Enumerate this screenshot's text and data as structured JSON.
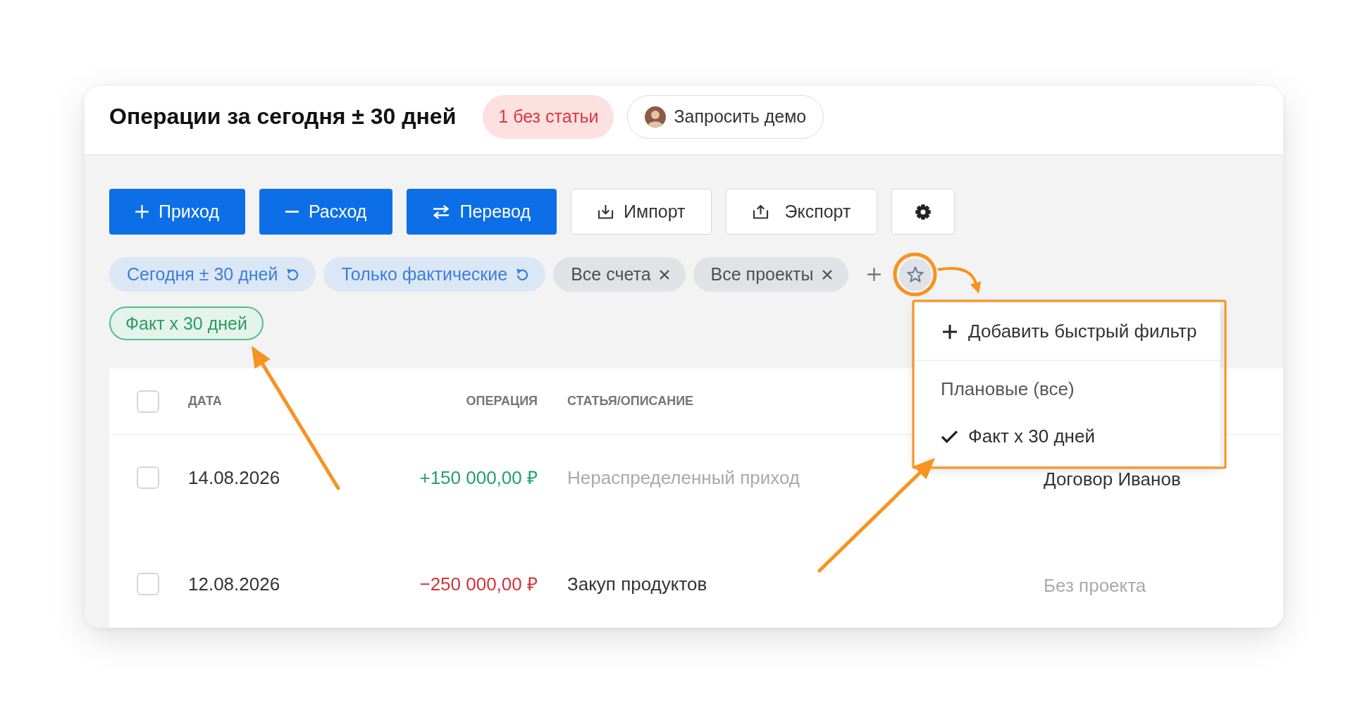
{
  "header": {
    "title": "Операции за сегодня ± 30 дней",
    "badge": "1 без статьи",
    "demo_button": "Запросить демо"
  },
  "toolbar": [
    {
      "kind": "income",
      "label": "Приход"
    },
    {
      "kind": "expense",
      "label": "Расход"
    },
    {
      "kind": "transfer",
      "label": "Перевод"
    },
    {
      "kind": "import",
      "label": "Импорт"
    },
    {
      "kind": "export",
      "label": "Экспорт"
    },
    {
      "kind": "settings"
    }
  ],
  "filters": [
    {
      "kind": "reset",
      "label": "Сегодня ± 30 дней"
    },
    {
      "kind": "reset",
      "label": "Только фактические"
    },
    {
      "kind": "removable",
      "label": "Все счета"
    },
    {
      "kind": "removable",
      "label": "Все проекты"
    }
  ],
  "quick_filter_menu": {
    "expanded": true,
    "add_label": "Добавить быстрый фильтр",
    "items": [
      {
        "label": "Плановые (все)",
        "selected": false
      },
      {
        "label": "Факт х 30 дней",
        "selected": true
      }
    ]
  },
  "active_quick_filters": [
    {
      "label": "Факт х 30 дней"
    }
  ],
  "table": {
    "header_checked": false,
    "columns": [
      {
        "label": "ДАТА"
      },
      {
        "label": "ОПЕРАЦИЯ"
      },
      {
        "label": "СТАТЬЯ/ОПИСАНИЕ"
      }
    ],
    "rows": [
      {
        "checked": false,
        "date": "14.08.2026",
        "amount": {
          "kind": "income",
          "text": "+150 000,00 ₽"
        },
        "description": {
          "text": "Нераспределенный приход",
          "muted": true
        },
        "project": {
          "text": "Договор Иванов",
          "muted": false
        }
      },
      {
        "checked": false,
        "date": "12.08.2026",
        "amount": {
          "kind": "expense",
          "text": "−250 000,00 ₽"
        },
        "description": {
          "text": "Закуп продуктов",
          "muted": false
        },
        "project": {
          "text": "Без проекта",
          "muted": true
        }
      }
    ]
  }
}
